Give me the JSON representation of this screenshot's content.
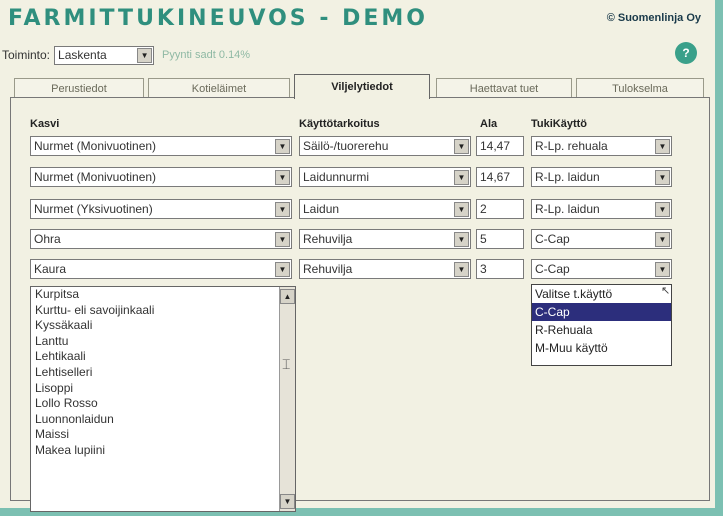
{
  "app": {
    "title": "FARMITTUKINEUVOS - DEMO",
    "copyright": "© Suomenlinja Oy"
  },
  "toolbar": {
    "label": "Toiminto:",
    "selected": "Laskenta",
    "hint": "Pyynti sadt 0.14%",
    "help_icon": "?"
  },
  "tabs": [
    {
      "label": "Perustiedot"
    },
    {
      "label": "Kotieläimet"
    },
    {
      "label": "Viljelytiedot"
    },
    {
      "label": "Haettavat tuet"
    },
    {
      "label": "Tulokselma"
    }
  ],
  "active_tab_index": 2,
  "columns": {
    "crop": "Kasvi",
    "usage": "Käyttötarkoitus",
    "area": "Ala",
    "support_use": "TukiKäyttö"
  },
  "rows": [
    {
      "crop": "Nurmet (Monivuotinen)",
      "usage": "Säilö-/tuorerehu",
      "area": "14,47",
      "support_use": "R-Lp. rehuala"
    },
    {
      "crop": "Nurmet (Monivuotinen)",
      "usage": "Laidunnurmi",
      "area": "14,67",
      "support_use": "R-Lp. laidun"
    },
    {
      "crop": "Nurmet (Yksivuotinen)",
      "usage": "Laidun",
      "area": "2",
      "support_use": "R-Lp. laidun"
    },
    {
      "crop": "Ohra",
      "usage": "Rehuvilja",
      "area": "5",
      "support_use": "C-Cap"
    },
    {
      "crop": "Kaura",
      "usage": "Rehuvilja",
      "area": "3",
      "support_use": "C-Cap"
    }
  ],
  "crop_dropdown_options": [
    "Kurpitsa",
    "Kurttu- eli savoijinkaali",
    "Kyssäkaali",
    "Lanttu",
    "Lehtikaali",
    "Lehtiselleri",
    "Lisoppi",
    "Lollo Rosso",
    "Luonnonlaidun",
    "Maissi",
    "Makea lupiini"
  ],
  "support_use_dropdown_options": [
    {
      "label": "Valitse t.käyttö",
      "selected": false
    },
    {
      "label": "C-Cap",
      "selected": true
    },
    {
      "label": "R-Rehuala",
      "selected": false
    },
    {
      "label": "M-Muu käyttö",
      "selected": false
    }
  ],
  "icons": {
    "dropdown": "dropdown-arrow-icon",
    "scroll_up": "scroll-up-icon",
    "scroll_down": "scroll-down-icon",
    "help": "help-icon"
  },
  "colors": {
    "background": "#f2f1e3",
    "accent": "#2f8f7e",
    "selection": "#2c2e7c",
    "border_teal": "#7cc0b2"
  }
}
